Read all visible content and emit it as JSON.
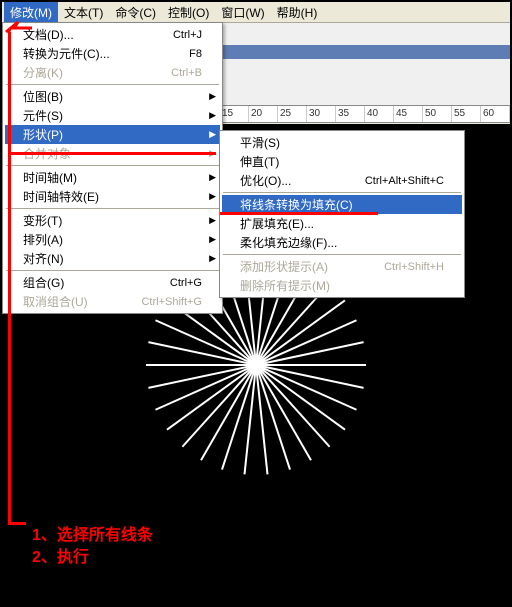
{
  "menubar": {
    "modify": "修改(M)",
    "text": "文本(T)",
    "command": "命令(C)",
    "control": "控制(O)",
    "window": "窗口(W)",
    "help": "帮助(H)"
  },
  "ruler": [
    "15",
    "20",
    "25",
    "30",
    "35",
    "40",
    "45",
    "50",
    "55",
    "60"
  ],
  "dropdown": {
    "document": "文档(D)...",
    "document_sc": "Ctrl+J",
    "to_symbol": "转换为元件(C)...",
    "to_symbol_sc": "F8",
    "separate": "分离(K)",
    "separate_sc": "Ctrl+B",
    "bitmap": "位图(B)",
    "symbol": "元件(S)",
    "shape": "形状(P)",
    "combine_obj": "合并对象",
    "timeline": "时间轴(M)",
    "timeline_fx": "时间轴特效(E)",
    "transform": "变形(T)",
    "arrange": "排列(A)",
    "align": "对齐(N)",
    "group": "组合(G)",
    "group_sc": "Ctrl+G",
    "ungroup": "取消组合(U)",
    "ungroup_sc": "Ctrl+Shift+G"
  },
  "submenu": {
    "smooth": "平滑(S)",
    "straighten": "伸直(T)",
    "optimize": "优化(O)...",
    "optimize_sc": "Ctrl+Alt+Shift+C",
    "lines_to_fills": "将线条转换为填充(C)",
    "expand_fill": "扩展填充(E)...",
    "soften_fill": "柔化填充边缘(F)...",
    "add_shape_hint": "添加形状提示(A)",
    "add_shape_hint_sc": "Ctrl+Shift+H",
    "remove_hints": "删除所有提示(M)"
  },
  "annotations": {
    "line1": "1、选择所有线条",
    "line2": "2、执行"
  }
}
